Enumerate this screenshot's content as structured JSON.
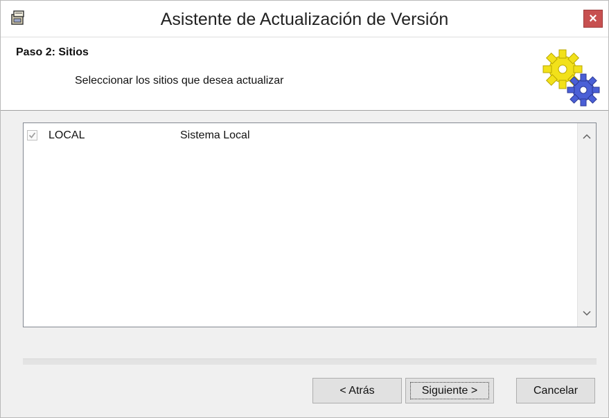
{
  "window": {
    "title": "Asistente de Actualización de Versión",
    "close_label": "×"
  },
  "header": {
    "step_title": "Paso 2: Sitios",
    "step_description": "Seleccionar los sitios que desea actualizar"
  },
  "sites": {
    "rows": [
      {
        "checked": true,
        "code": "LOCAL",
        "name": "Sistema Local"
      }
    ]
  },
  "scrollbar": {
    "up": "^",
    "down": "v"
  },
  "buttons": {
    "back_label": "< Atrás",
    "next_label": "Siguiente >",
    "cancel_label": "Cancelar"
  },
  "colors": {
    "close_button": "#c75050",
    "gear_yellow": "#f2e11a",
    "gear_blue": "#4a5fd6"
  },
  "icons": {
    "app": "setup-wizard-icon",
    "header": "gears-icon"
  }
}
